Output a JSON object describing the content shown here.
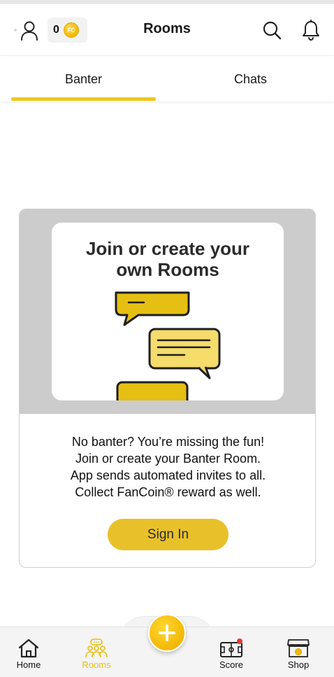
{
  "header": {
    "title": "Rooms",
    "coin_count": "0",
    "coin_badge_text": "FC",
    "profile_icon": "user-icon",
    "coin_icon": "fancoin-icon",
    "search_icon": "search-icon",
    "bell_icon": "bell-icon"
  },
  "tabs": [
    {
      "label": "Banter",
      "active": true
    },
    {
      "label": "Chats",
      "active": false
    }
  ],
  "card": {
    "promo_title_line1": "Join or create your",
    "promo_title_line2": "own Rooms",
    "message_lines": [
      "No banter? You’re missing the fun!",
      "Join or create your Banter Room.",
      "App sends automated invites to all.",
      "Collect FanCoin® reward as well."
    ],
    "sign_in_label": "Sign In"
  },
  "bottom_nav": {
    "items": [
      {
        "label": "Home",
        "icon": "home-icon",
        "active": false
      },
      {
        "label": "Rooms",
        "icon": "rooms-icon",
        "active": true
      },
      {
        "label": "Score",
        "icon": "scoreboard-icon",
        "active": false
      },
      {
        "label": "Shop",
        "icon": "shop-icon",
        "active": false
      }
    ],
    "fab_icon": "plus-icon"
  },
  "colors": {
    "accent": "#f2c61b",
    "button": "#e8c12a",
    "active_nav": "#e7bd0f",
    "card_media_bg": "#cccccc",
    "bubble_fill": "#e6bf13",
    "bubble_fill_light": "#f5dc6b",
    "bubble_stroke": "#1f1f1f"
  }
}
